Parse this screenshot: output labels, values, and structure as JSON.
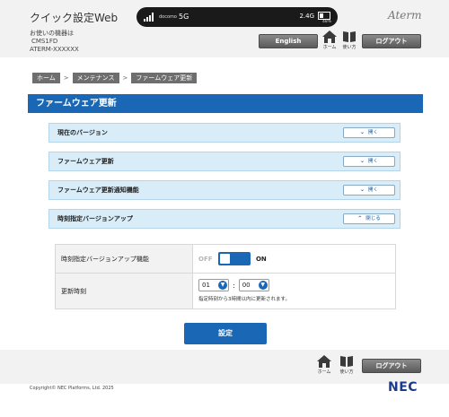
{
  "header": {
    "app_title": "クイック設定Web",
    "device_lines": [
      "お使いの機器は",
      "CMS1FD",
      "ATERM-XXXXXX"
    ],
    "brand": "Aterm",
    "english_label": "English",
    "home_label": "ホーム",
    "help_label": "使い方",
    "logout_label": "ログアウト"
  },
  "status": {
    "carrier": "docomo",
    "network": "5G",
    "frequency": "2.4G",
    "battery": "48%"
  },
  "breadcrumb": [
    "ホーム",
    "メンテナンス",
    "ファームウェア更新"
  ],
  "page_title": "ファームウェア更新",
  "accordion": [
    {
      "label": "現在のバージョン",
      "button": "開く",
      "open": false
    },
    {
      "label": "ファームウェア更新",
      "button": "開く",
      "open": false
    },
    {
      "label": "ファームウェア更新通知機能",
      "button": "開く",
      "open": false
    },
    {
      "label": "時刻指定バージョンアップ",
      "button": "閉じる",
      "open": true
    }
  ],
  "settings": {
    "function_label": "時刻指定バージョンアップ機能",
    "toggle_off": "OFF",
    "toggle_on": "ON",
    "enabled": true,
    "time_label": "更新時刻",
    "hour": "01",
    "minute": "00",
    "time_note": "指定時刻から3時間以内に更新されます。"
  },
  "save_label": "設定",
  "footer": {
    "home_label": "ホーム",
    "help_label": "使い方",
    "logout_label": "ログアウト",
    "copyright": "Copyright© NEC Platforms, Ltd. 2025",
    "logo": "NEC"
  },
  "colors": {
    "accent": "#1a68b5",
    "accordion_bg": "#d9edf9",
    "header_bg": "#f2f2f2"
  }
}
